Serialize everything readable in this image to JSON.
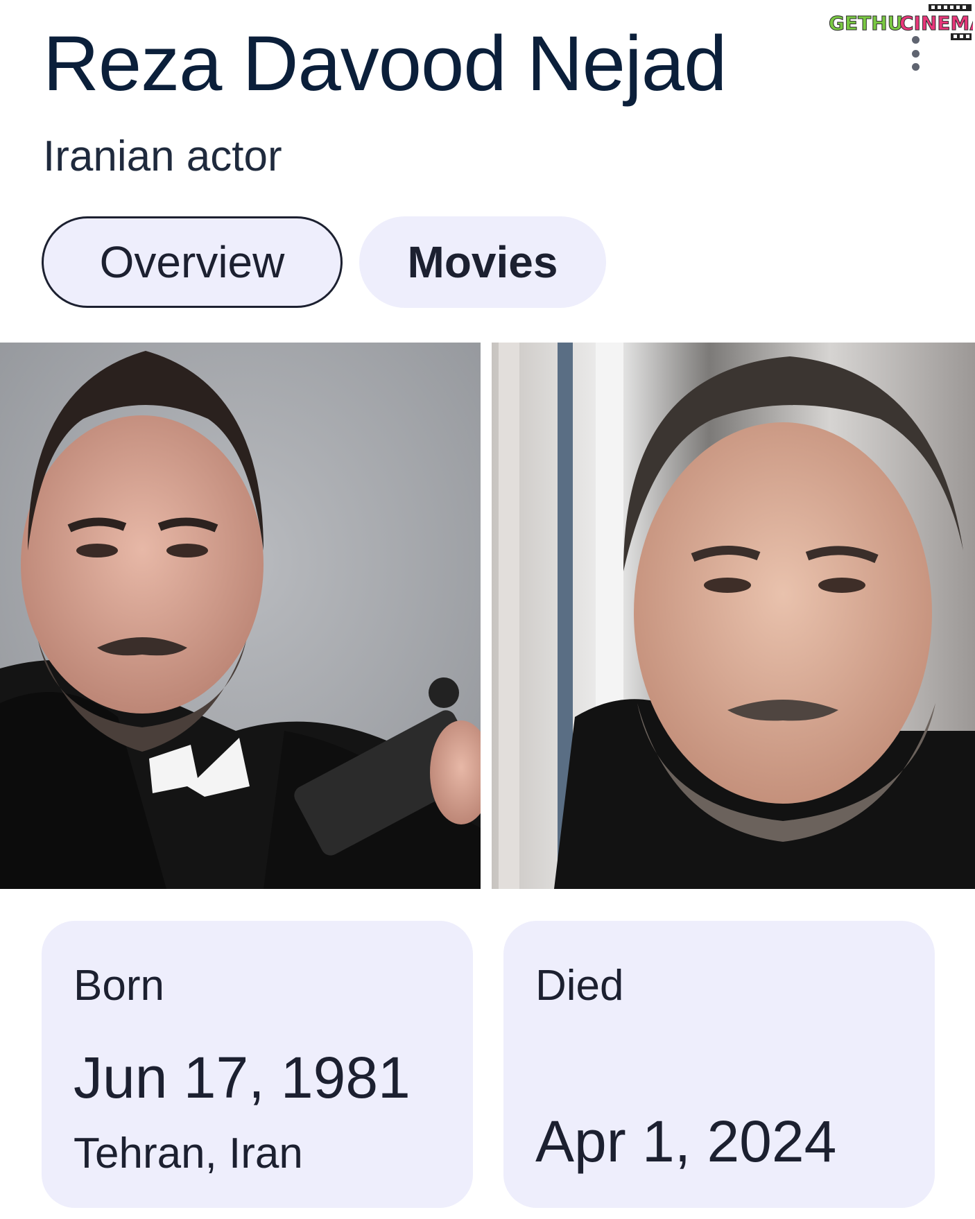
{
  "header": {
    "title": "Reza Davood Nejad",
    "subtitle": "Iranian actor",
    "watermark_text": "GETHUCINEMA"
  },
  "tabs": [
    {
      "label": "Overview",
      "active": true
    },
    {
      "label": "Movies",
      "active": false
    }
  ],
  "facts": {
    "born": {
      "label": "Born",
      "date": "Jun 17, 1981",
      "place": "Tehran, Iran"
    },
    "died": {
      "label": "Died",
      "date": "Apr 1, 2024"
    }
  },
  "colors": {
    "title": "#0b1f3a",
    "chip_background": "#eeeefc",
    "watermark_green": "#7ac943",
    "watermark_pink": "#e8387a"
  },
  "icons": [
    "more-vert-icon"
  ]
}
